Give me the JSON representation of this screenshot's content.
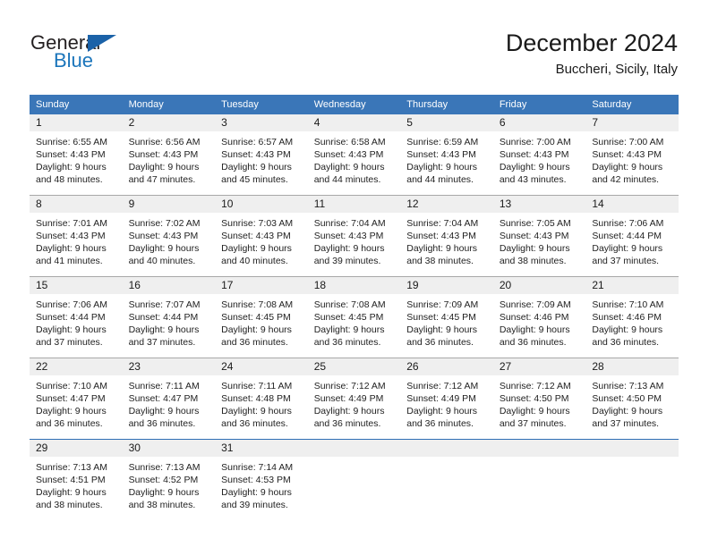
{
  "brand": {
    "name_part1": "General",
    "name_part2": "Blue"
  },
  "header": {
    "title": "December 2024",
    "subtitle": "Buccheri, Sicily, Italy"
  },
  "colors": {
    "header_blue": "#3a76b8",
    "brand_blue": "#1b75bb",
    "daynum_band": "#efefef",
    "row_divider": "#a8a8a8",
    "last_row_divider": "#2f6eb5"
  },
  "weekdays": [
    "Sunday",
    "Monday",
    "Tuesday",
    "Wednesday",
    "Thursday",
    "Friday",
    "Saturday"
  ],
  "weeks": [
    [
      {
        "day": "1",
        "sunrise": "Sunrise: 6:55 AM",
        "sunset": "Sunset: 4:43 PM",
        "daylight1": "Daylight: 9 hours",
        "daylight2": "and 48 minutes."
      },
      {
        "day": "2",
        "sunrise": "Sunrise: 6:56 AM",
        "sunset": "Sunset: 4:43 PM",
        "daylight1": "Daylight: 9 hours",
        "daylight2": "and 47 minutes."
      },
      {
        "day": "3",
        "sunrise": "Sunrise: 6:57 AM",
        "sunset": "Sunset: 4:43 PM",
        "daylight1": "Daylight: 9 hours",
        "daylight2": "and 45 minutes."
      },
      {
        "day": "4",
        "sunrise": "Sunrise: 6:58 AM",
        "sunset": "Sunset: 4:43 PM",
        "daylight1": "Daylight: 9 hours",
        "daylight2": "and 44 minutes."
      },
      {
        "day": "5",
        "sunrise": "Sunrise: 6:59 AM",
        "sunset": "Sunset: 4:43 PM",
        "daylight1": "Daylight: 9 hours",
        "daylight2": "and 44 minutes."
      },
      {
        "day": "6",
        "sunrise": "Sunrise: 7:00 AM",
        "sunset": "Sunset: 4:43 PM",
        "daylight1": "Daylight: 9 hours",
        "daylight2": "and 43 minutes."
      },
      {
        "day": "7",
        "sunrise": "Sunrise: 7:00 AM",
        "sunset": "Sunset: 4:43 PM",
        "daylight1": "Daylight: 9 hours",
        "daylight2": "and 42 minutes."
      }
    ],
    [
      {
        "day": "8",
        "sunrise": "Sunrise: 7:01 AM",
        "sunset": "Sunset: 4:43 PM",
        "daylight1": "Daylight: 9 hours",
        "daylight2": "and 41 minutes."
      },
      {
        "day": "9",
        "sunrise": "Sunrise: 7:02 AM",
        "sunset": "Sunset: 4:43 PM",
        "daylight1": "Daylight: 9 hours",
        "daylight2": "and 40 minutes."
      },
      {
        "day": "10",
        "sunrise": "Sunrise: 7:03 AM",
        "sunset": "Sunset: 4:43 PM",
        "daylight1": "Daylight: 9 hours",
        "daylight2": "and 40 minutes."
      },
      {
        "day": "11",
        "sunrise": "Sunrise: 7:04 AM",
        "sunset": "Sunset: 4:43 PM",
        "daylight1": "Daylight: 9 hours",
        "daylight2": "and 39 minutes."
      },
      {
        "day": "12",
        "sunrise": "Sunrise: 7:04 AM",
        "sunset": "Sunset: 4:43 PM",
        "daylight1": "Daylight: 9 hours",
        "daylight2": "and 38 minutes."
      },
      {
        "day": "13",
        "sunrise": "Sunrise: 7:05 AM",
        "sunset": "Sunset: 4:43 PM",
        "daylight1": "Daylight: 9 hours",
        "daylight2": "and 38 minutes."
      },
      {
        "day": "14",
        "sunrise": "Sunrise: 7:06 AM",
        "sunset": "Sunset: 4:44 PM",
        "daylight1": "Daylight: 9 hours",
        "daylight2": "and 37 minutes."
      }
    ],
    [
      {
        "day": "15",
        "sunrise": "Sunrise: 7:06 AM",
        "sunset": "Sunset: 4:44 PM",
        "daylight1": "Daylight: 9 hours",
        "daylight2": "and 37 minutes."
      },
      {
        "day": "16",
        "sunrise": "Sunrise: 7:07 AM",
        "sunset": "Sunset: 4:44 PM",
        "daylight1": "Daylight: 9 hours",
        "daylight2": "and 37 minutes."
      },
      {
        "day": "17",
        "sunrise": "Sunrise: 7:08 AM",
        "sunset": "Sunset: 4:45 PM",
        "daylight1": "Daylight: 9 hours",
        "daylight2": "and 36 minutes."
      },
      {
        "day": "18",
        "sunrise": "Sunrise: 7:08 AM",
        "sunset": "Sunset: 4:45 PM",
        "daylight1": "Daylight: 9 hours",
        "daylight2": "and 36 minutes."
      },
      {
        "day": "19",
        "sunrise": "Sunrise: 7:09 AM",
        "sunset": "Sunset: 4:45 PM",
        "daylight1": "Daylight: 9 hours",
        "daylight2": "and 36 minutes."
      },
      {
        "day": "20",
        "sunrise": "Sunrise: 7:09 AM",
        "sunset": "Sunset: 4:46 PM",
        "daylight1": "Daylight: 9 hours",
        "daylight2": "and 36 minutes."
      },
      {
        "day": "21",
        "sunrise": "Sunrise: 7:10 AM",
        "sunset": "Sunset: 4:46 PM",
        "daylight1": "Daylight: 9 hours",
        "daylight2": "and 36 minutes."
      }
    ],
    [
      {
        "day": "22",
        "sunrise": "Sunrise: 7:10 AM",
        "sunset": "Sunset: 4:47 PM",
        "daylight1": "Daylight: 9 hours",
        "daylight2": "and 36 minutes."
      },
      {
        "day": "23",
        "sunrise": "Sunrise: 7:11 AM",
        "sunset": "Sunset: 4:47 PM",
        "daylight1": "Daylight: 9 hours",
        "daylight2": "and 36 minutes."
      },
      {
        "day": "24",
        "sunrise": "Sunrise: 7:11 AM",
        "sunset": "Sunset: 4:48 PM",
        "daylight1": "Daylight: 9 hours",
        "daylight2": "and 36 minutes."
      },
      {
        "day": "25",
        "sunrise": "Sunrise: 7:12 AM",
        "sunset": "Sunset: 4:49 PM",
        "daylight1": "Daylight: 9 hours",
        "daylight2": "and 36 minutes."
      },
      {
        "day": "26",
        "sunrise": "Sunrise: 7:12 AM",
        "sunset": "Sunset: 4:49 PM",
        "daylight1": "Daylight: 9 hours",
        "daylight2": "and 36 minutes."
      },
      {
        "day": "27",
        "sunrise": "Sunrise: 7:12 AM",
        "sunset": "Sunset: 4:50 PM",
        "daylight1": "Daylight: 9 hours",
        "daylight2": "and 37 minutes."
      },
      {
        "day": "28",
        "sunrise": "Sunrise: 7:13 AM",
        "sunset": "Sunset: 4:50 PM",
        "daylight1": "Daylight: 9 hours",
        "daylight2": "and 37 minutes."
      }
    ],
    [
      {
        "day": "29",
        "sunrise": "Sunrise: 7:13 AM",
        "sunset": "Sunset: 4:51 PM",
        "daylight1": "Daylight: 9 hours",
        "daylight2": "and 38 minutes."
      },
      {
        "day": "30",
        "sunrise": "Sunrise: 7:13 AM",
        "sunset": "Sunset: 4:52 PM",
        "daylight1": "Daylight: 9 hours",
        "daylight2": "and 38 minutes."
      },
      {
        "day": "31",
        "sunrise": "Sunrise: 7:14 AM",
        "sunset": "Sunset: 4:53 PM",
        "daylight1": "Daylight: 9 hours",
        "daylight2": "and 39 minutes."
      },
      {
        "day": "",
        "sunrise": "",
        "sunset": "",
        "daylight1": "",
        "daylight2": ""
      },
      {
        "day": "",
        "sunrise": "",
        "sunset": "",
        "daylight1": "",
        "daylight2": ""
      },
      {
        "day": "",
        "sunrise": "",
        "sunset": "",
        "daylight1": "",
        "daylight2": ""
      },
      {
        "day": "",
        "sunrise": "",
        "sunset": "",
        "daylight1": "",
        "daylight2": ""
      }
    ]
  ]
}
